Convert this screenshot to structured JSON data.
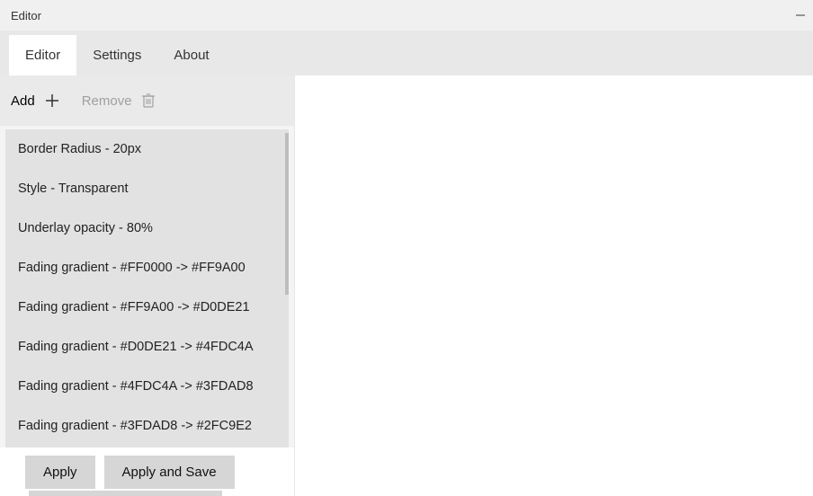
{
  "window": {
    "title": "Editor"
  },
  "tabs": [
    {
      "label": "Editor",
      "active": true
    },
    {
      "label": "Settings",
      "active": false
    },
    {
      "label": "About",
      "active": false
    }
  ],
  "toolbar": {
    "add_label": "Add",
    "remove_label": "Remove"
  },
  "list_items": [
    "Border Radius - 20px",
    "Style - Transparent",
    "Underlay opacity - 80%",
    "Fading gradient - #FF0000 -> #FF9A00",
    "Fading gradient - #FF9A00 -> #D0DE21",
    "Fading gradient - #D0DE21 -> #4FDC4A",
    "Fading gradient - #4FDC4A -> #3FDAD8",
    "Fading gradient - #3FDAD8 -> #2FC9E2"
  ],
  "buttons": {
    "apply": "Apply",
    "apply_save": "Apply and Save"
  }
}
